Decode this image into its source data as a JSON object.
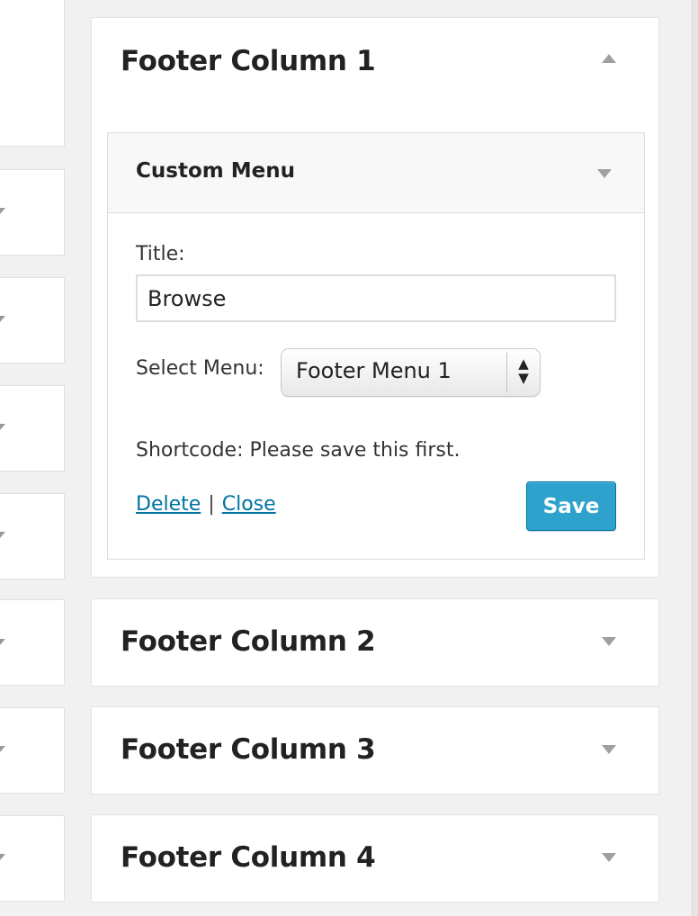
{
  "sidebar_areas": [
    {
      "title": "Footer Column 1",
      "expanded": true,
      "toggle_icon": "chevron-up-icon"
    },
    {
      "title": "Footer Column 2",
      "expanded": false,
      "toggle_icon": "chevron-down-icon"
    },
    {
      "title": "Footer Column 3",
      "expanded": false,
      "toggle_icon": "chevron-down-icon"
    },
    {
      "title": "Footer Column 4",
      "expanded": false,
      "toggle_icon": "chevron-down-icon"
    }
  ],
  "widget": {
    "title": "Custom Menu",
    "toggle_icon": "chevron-down-icon",
    "title_label": "Title:",
    "title_value": "Browse",
    "select_label": "Select Menu:",
    "select_value": "Footer Menu 1",
    "shortcode_text": "Shortcode: Please save this first.",
    "delete_label": "Delete",
    "separator": "|",
    "close_label": "Close",
    "save_label": "Save"
  },
  "colors": {
    "background": "#f1f1f1",
    "link": "#0074a2",
    "save_button": "#2ea2cc"
  }
}
